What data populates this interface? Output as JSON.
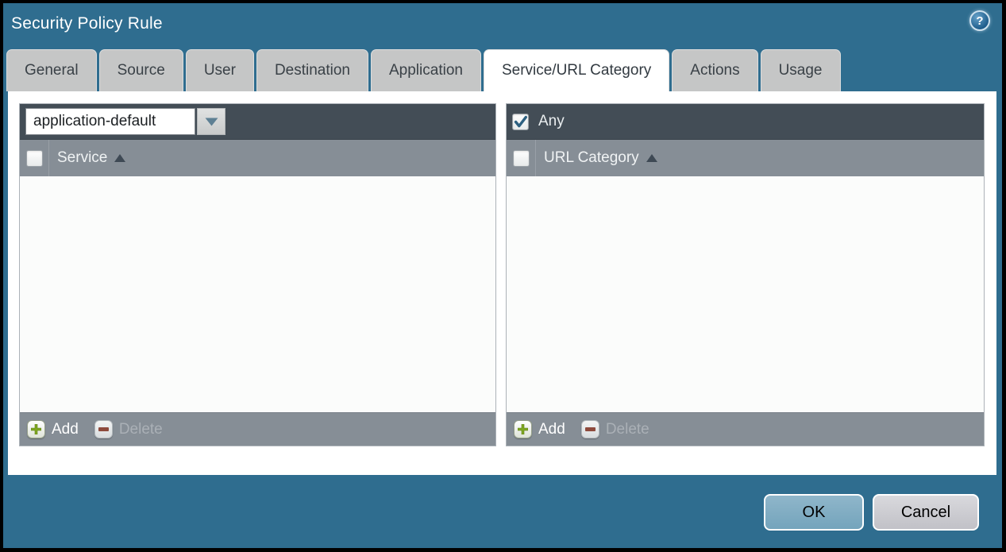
{
  "window": {
    "title": "Security Policy Rule"
  },
  "help": {
    "glyph": "?"
  },
  "tabs": [
    {
      "label": "General"
    },
    {
      "label": "Source"
    },
    {
      "label": "User"
    },
    {
      "label": "Destination"
    },
    {
      "label": "Application"
    },
    {
      "label": "Service/URL Category"
    },
    {
      "label": "Actions"
    },
    {
      "label": "Usage"
    }
  ],
  "active_tab": "Service/URL Category",
  "service_panel": {
    "dropdown_value": "application-default",
    "column_header": "Service",
    "rows": [],
    "add_label": "Add",
    "delete_label": "Delete",
    "delete_enabled": false
  },
  "url_panel": {
    "any_label": "Any",
    "any_checked": true,
    "column_header": "URL Category",
    "rows": [],
    "add_label": "Add",
    "delete_label": "Delete",
    "delete_enabled": false
  },
  "buttons": {
    "ok": "OK",
    "cancel": "Cancel"
  },
  "colors": {
    "background_teal": "#2F6D8F",
    "panel_toolbar_dark": "#434D56",
    "panel_gray": "#868E96",
    "tab_gray": "#C5C6C6",
    "active_tab": "#FFFFFF",
    "ok_button": "#7FADC4",
    "cancel_button": "#C9C9CD",
    "add_green": "#7FA821",
    "delete_red": "#8E4A3C",
    "check_blue": "#2D6080"
  }
}
